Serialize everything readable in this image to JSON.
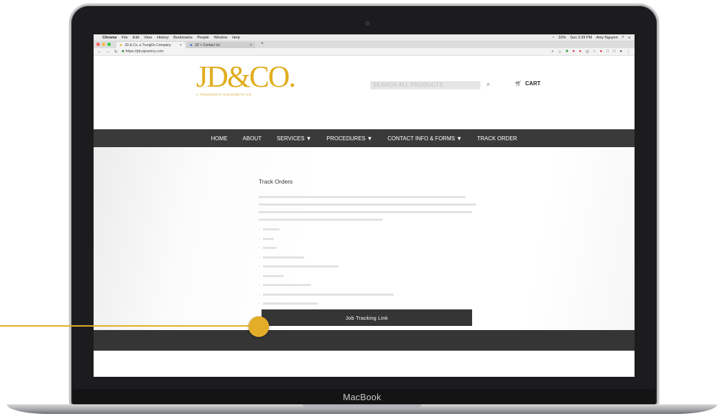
{
  "device": {
    "label": "MacBook"
  },
  "menubar": {
    "app": "Chrome",
    "items": [
      "File",
      "Edit",
      "View",
      "History",
      "Bookmarks",
      "People",
      "Window",
      "Help"
    ],
    "status": {
      "battery": "33%",
      "clock": "Sun 2:39 PM",
      "user": "Amy Nguyen"
    }
  },
  "tabs": [
    {
      "title": "JD & Co, a TrungDo Company"
    },
    {
      "title": "JD > Contact Us"
    }
  ],
  "url": "https://jdcojewelry.com",
  "site": {
    "logo_text": "JD&CO.",
    "logo_sub": "A TRUNGDO'S GOLDSMITH CO.",
    "search_placeholder": "SEARCH ALL PRODUCTS",
    "cart_label": "CART",
    "nav": [
      "HOME",
      "ABOUT",
      "SERVICES ▼",
      "PROCEDURES ▼",
      "CONTACT INFO & FORMS ▼",
      "TRACK ORDER"
    ]
  },
  "page": {
    "title": "Track Orders",
    "button_label": "Job Tracking Link"
  },
  "colors": {
    "accent": "#e3ad2a",
    "logo": "#e0ad1e",
    "nav_bg": "#3a3a3a"
  }
}
